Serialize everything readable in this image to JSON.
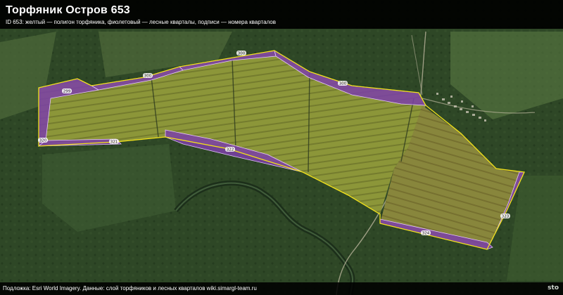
{
  "header": {
    "title": "Торфяник Остров 653",
    "subtitle": "ID 653: желтый — полигон торфяника, фиолетовый — лесные кварталы, подписи — номера кварталов"
  },
  "footer": {
    "attribution": "Подложка: Esri World Imagery. Данные: слой торфяников и лесных кварталов wiki.simargl-team.ru",
    "logo": "sto"
  },
  "legend_colors": {
    "peatland_outline": "#f2e21a",
    "forest_quarter": "#7b3fa8",
    "forest_quarter_outline": "#e0c0ff",
    "imagery_forest": "#2f4a27",
    "imagery_peat": "#7f8a3a"
  },
  "quarter_labels": {
    "q1": "299",
    "q2": "300",
    "q3": "300",
    "q4": "300",
    "q5": "320",
    "q6": "321",
    "q7": "322",
    "q8": "323",
    "q9": "324",
    "q10": "325"
  }
}
